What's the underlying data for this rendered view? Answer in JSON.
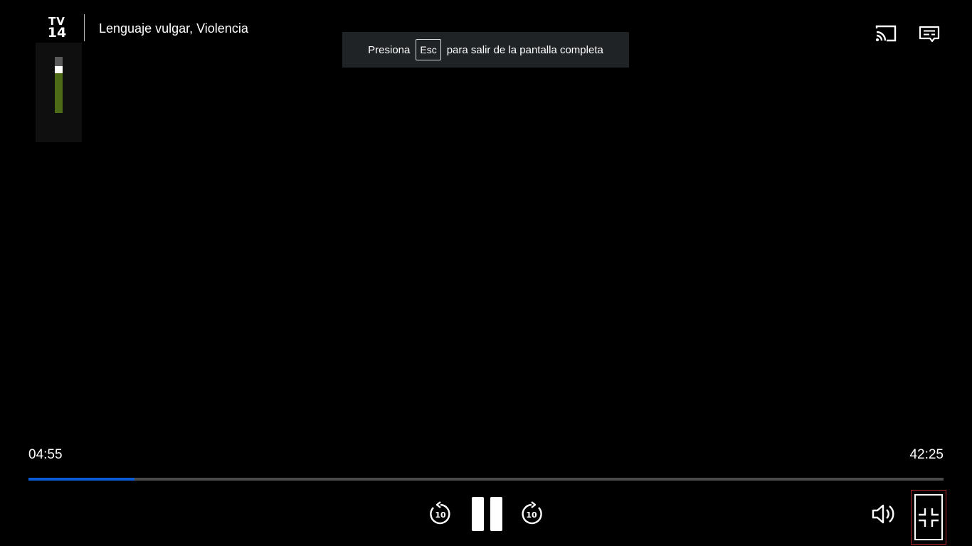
{
  "rating": {
    "tv": "TV",
    "age": "14",
    "descriptors": "Lenguaje vulgar, Violencia"
  },
  "toast": {
    "prefix": "Presiona",
    "key": "Esc",
    "suffix": "para salir de la pantalla completa"
  },
  "playback": {
    "current_time": "04:55",
    "total_time": "42:25",
    "progress_fraction": 0.116,
    "skip_back_label": "10",
    "skip_forward_label": "10"
  },
  "icons": {
    "cast": "cast-icon",
    "captions": "captions-icon",
    "rewind": "rewind-10-icon",
    "pause": "pause-icon",
    "forward": "forward-10-icon",
    "volume": "volume-icon",
    "exit_fullscreen": "exit-fullscreen-icon"
  },
  "colors": {
    "progress_fill": "#0b5bd6",
    "progress_track": "#4a4a4a",
    "toast_bg": "#202326",
    "focus_outline": "#b3262b"
  }
}
